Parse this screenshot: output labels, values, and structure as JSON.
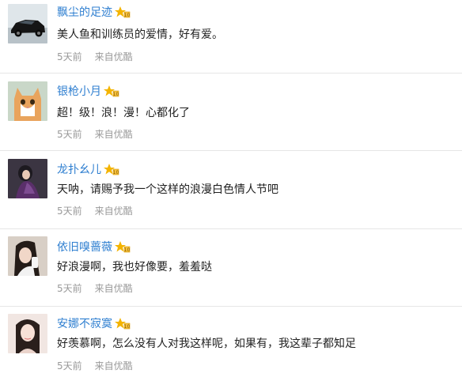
{
  "comments": [
    {
      "user": "飘尘的足迹",
      "text": "美人鱼和训练员的爱情，好有爱。",
      "time": "5天前",
      "source": "来自优酷",
      "avatar": "car-avatar"
    },
    {
      "user": "银枪小月",
      "text": "超！级！浪！漫！心都化了",
      "time": "5天前",
      "source": "来自优酷",
      "avatar": "cat-avatar"
    },
    {
      "user": "龙扑幺儿",
      "text": "天呐，请赐予我一个这样的浪漫白色情人节吧",
      "time": "5天前",
      "source": "来自优酷",
      "avatar": "woman-avatar"
    },
    {
      "user": "依旧嗅蔷薇",
      "text": "好浪漫啊，我也好像要，羞羞哒",
      "time": "5天前",
      "source": "来自优酷",
      "avatar": "girl-avatar"
    },
    {
      "user": "安娜不寂寞",
      "text": "好羡慕啊，怎么没有人对我这样呢，如果有，我这辈子都知足",
      "time": "5天前",
      "source": "来自优酷",
      "avatar": "selfie-avatar"
    }
  ],
  "colors": {
    "username": "#2f7fd0",
    "meta": "#999999",
    "badge": "#f4b400"
  }
}
